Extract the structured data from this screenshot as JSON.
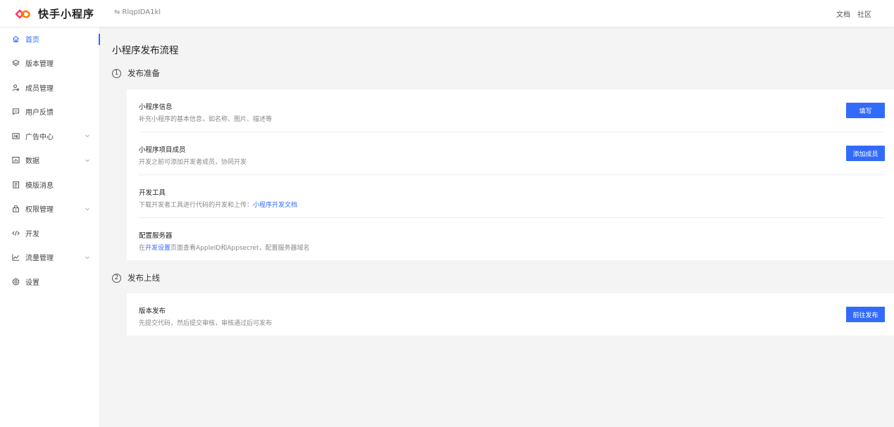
{
  "header": {
    "brand": "快手小程序",
    "app_id": "RlqpIDA1kl",
    "switch_icon": "swap-icon",
    "links": [
      "文档",
      "社区"
    ]
  },
  "sidebar": {
    "items": [
      {
        "label": "首页",
        "icon": "home-icon",
        "active": true
      },
      {
        "label": "版本管理",
        "icon": "layers-icon"
      },
      {
        "label": "成员管理",
        "icon": "users-icon"
      },
      {
        "label": "用户反馈",
        "icon": "message-icon"
      },
      {
        "label": "广告中心",
        "icon": "ad-icon",
        "expandable": true
      },
      {
        "label": "数据",
        "icon": "chart-icon",
        "expandable": true
      },
      {
        "label": "模版消息",
        "icon": "template-icon"
      },
      {
        "label": "权限管理",
        "icon": "lock-icon",
        "expandable": true
      },
      {
        "label": "开发",
        "icon": "code-icon"
      },
      {
        "label": "流量管理",
        "icon": "trend-icon",
        "expandable": true
      },
      {
        "label": "设置",
        "icon": "gear-icon"
      }
    ]
  },
  "main": {
    "title": "小程序发布流程",
    "sections": [
      {
        "num": "1",
        "title": "发布准备",
        "rows": [
          {
            "title": "小程序信息",
            "desc": "补充小程序的基本信息，如名称、图片、描述等",
            "button": "填写"
          },
          {
            "title": "小程序项目成员",
            "desc": "开发之前可添加开发者成员，协同开发",
            "button": "添加成员"
          },
          {
            "title": "开发工具",
            "desc_prefix": "下载开发者工具进行代码的开发和上传：",
            "desc_link": "小程序开发文档"
          },
          {
            "title": "配置服务器",
            "desc_prefix": "在",
            "desc_link": "开发设置",
            "desc_suffix": "页面查看AppleID和Appsecret，配置服务器域名"
          }
        ]
      },
      {
        "num": "2",
        "title": "发布上线",
        "rows": [
          {
            "title": "版本发布",
            "desc": "先提交代码，然后提交审核，审核通过后可发布",
            "button": "前往发布"
          }
        ]
      }
    ]
  },
  "colors": {
    "accent": "#326bfb",
    "brand_logo": "#fe3666"
  }
}
